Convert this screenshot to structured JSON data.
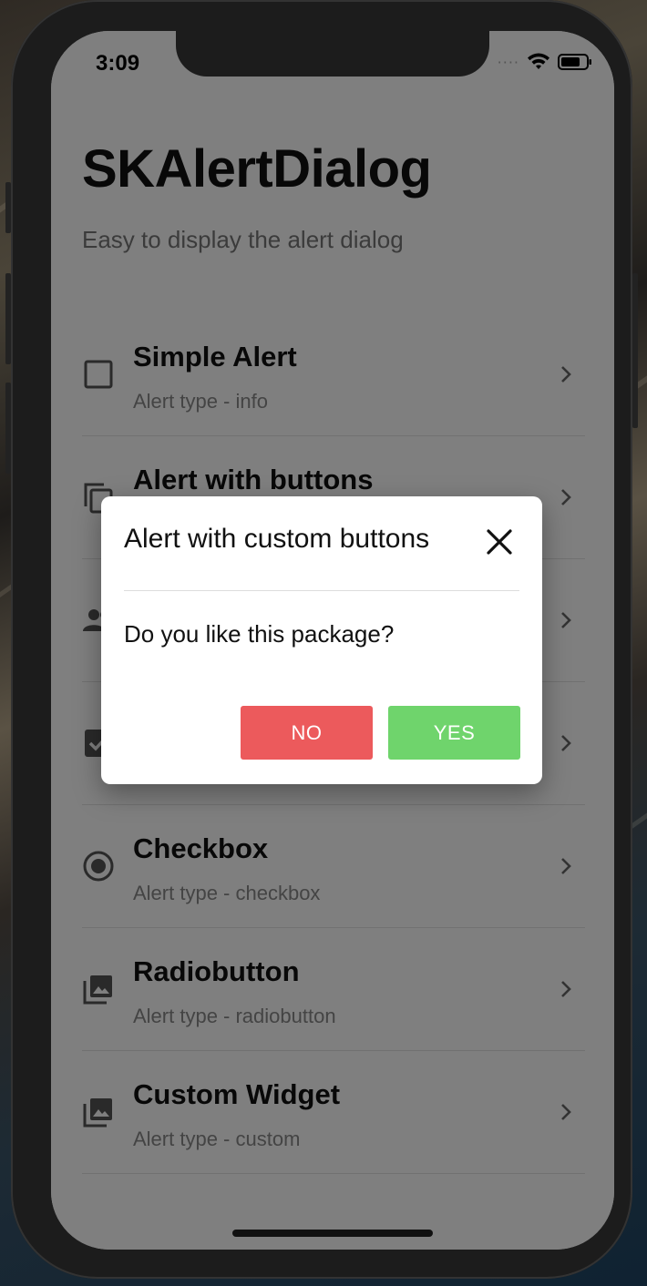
{
  "status_bar": {
    "time": "3:09"
  },
  "app": {
    "title": "SKAlertDialog",
    "subtitle": "Easy to display the alert dialog"
  },
  "list": {
    "items": [
      {
        "title": "Simple Alert",
        "subtitle": "Alert type - info",
        "icon": "checkbox-outline-icon"
      },
      {
        "title": "Alert with buttons",
        "subtitle": "",
        "icon": "copy-icon"
      },
      {
        "title": "",
        "subtitle": "",
        "icon": "people-icon"
      },
      {
        "title": "",
        "subtitle": "",
        "icon": "checkbox-checked-icon"
      },
      {
        "title": "Checkbox",
        "subtitle": "Alert type - checkbox",
        "icon": "radio-button-icon"
      },
      {
        "title": "Radiobutton",
        "subtitle": "Alert type - radiobutton",
        "icon": "image-library-icon"
      },
      {
        "title": "Custom Widget",
        "subtitle": "Alert type - custom",
        "icon": "image-library-icon"
      }
    ]
  },
  "dialog": {
    "title": "Alert with custom buttons",
    "message": "Do you like this package?",
    "no_label": "NO",
    "yes_label": "YES",
    "no_color": "#ec5a5c",
    "yes_color": "#6fd46c"
  }
}
